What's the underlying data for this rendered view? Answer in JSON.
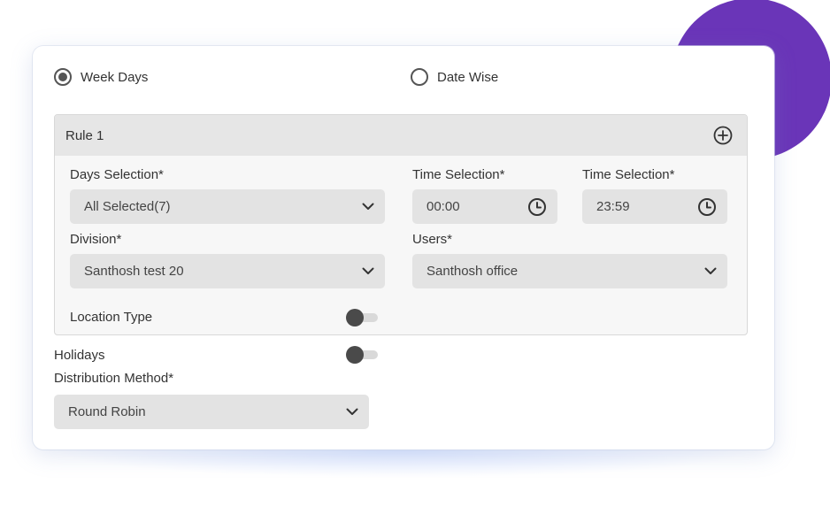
{
  "mode_options": [
    {
      "label": "Week Days",
      "selected": true
    },
    {
      "label": "Date Wise",
      "selected": false
    }
  ],
  "rule": {
    "title": "Rule 1",
    "add_icon": "plus-circle-icon",
    "days_selection": {
      "label": "Days Selection*",
      "value": "All Selected(7)"
    },
    "time_start": {
      "label": "Time Selection*",
      "value": "00:00"
    },
    "time_end": {
      "label": "Time Selection*",
      "value": "23:59"
    },
    "division": {
      "label": "Division*",
      "value": "Santhosh test 20"
    },
    "users": {
      "label": "Users*",
      "value": "Santhosh office"
    },
    "location_type": {
      "label": "Location Type",
      "enabled": false
    }
  },
  "holidays": {
    "label": "Holidays",
    "enabled": false
  },
  "distribution_method": {
    "label": "Distribution Method*",
    "value": "Round Robin"
  },
  "colors": {
    "accent_circle": "#6a35b8",
    "field_background": "#e3e3e3",
    "rule_header": "#e6e6e6",
    "toggle_knob": "#4a4a4a"
  }
}
